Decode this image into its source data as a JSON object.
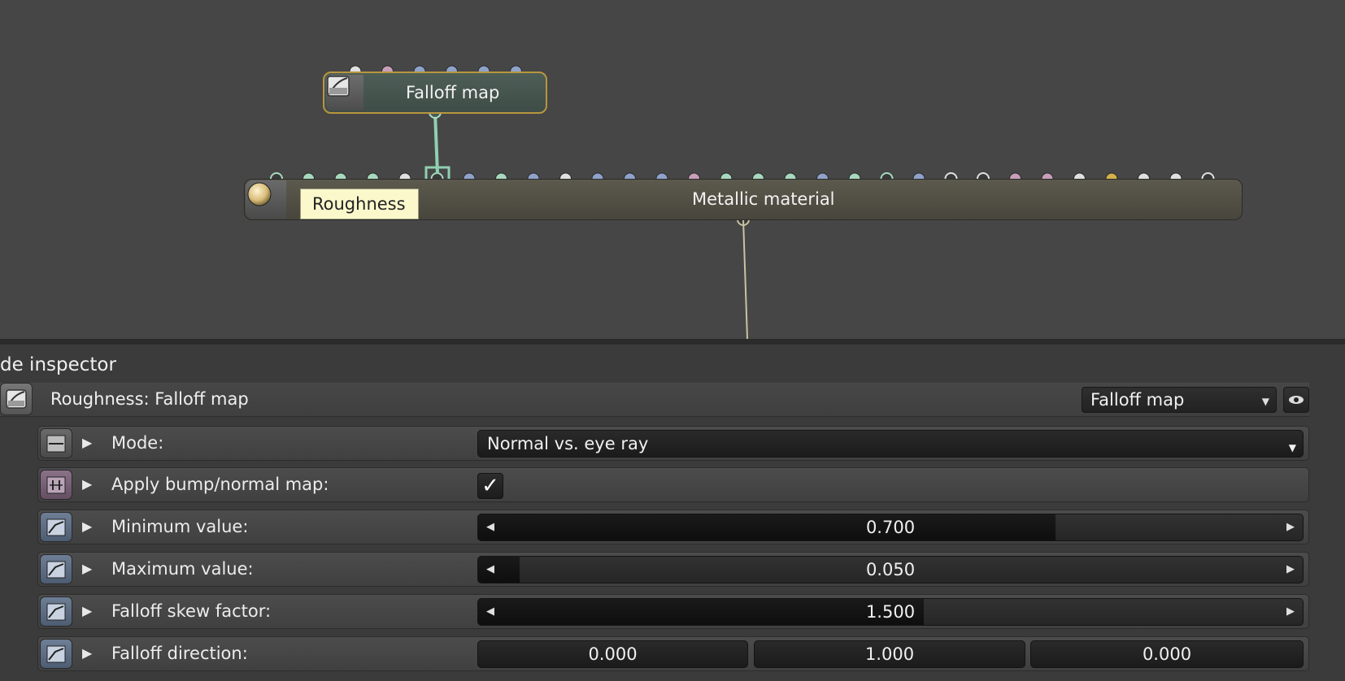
{
  "graph": {
    "falloff_node": {
      "title": "Falloff map",
      "icon": "falloff-map-icon"
    },
    "metallic_node": {
      "title": "Metallic material",
      "icon": "material-sphere-icon"
    },
    "tooltip": "Roughness",
    "colors": {
      "falloff_border": "#b8963e",
      "connection": "#8fd0b0",
      "output_wire": "#c9c2a2"
    }
  },
  "inspector": {
    "title": "de inspector",
    "header": {
      "label": "Roughness: Falloff map",
      "type_select": "Falloff map",
      "icon": "falloff-map-icon",
      "visibility_icon": "eye-icon"
    },
    "properties": [
      {
        "label": "Mode:",
        "kind": "select",
        "value": "Normal vs. eye ray",
        "icon": "enum-icon"
      },
      {
        "label": "Apply bump/normal map:",
        "kind": "checkbox",
        "checked": true,
        "check_glyph": "✓",
        "icon": "bool-icon"
      },
      {
        "label": "Minimum value:",
        "kind": "slider",
        "value": "0.700",
        "fraction": 0.7,
        "icon": "float-icon"
      },
      {
        "label": "Maximum value:",
        "kind": "slider",
        "value": "0.050",
        "fraction": 0.05,
        "icon": "float-icon"
      },
      {
        "label": "Falloff skew factor:",
        "kind": "slider",
        "value": "1.500",
        "fraction": 0.54,
        "icon": "float-icon"
      },
      {
        "label": "Falloff direction:",
        "kind": "vector",
        "values": [
          "0.000",
          "1.000",
          "0.000"
        ],
        "icon": "float-icon"
      }
    ],
    "arrows": {
      "expand": "▶",
      "left": "◀",
      "right": "▶",
      "dropdown": "▼"
    }
  }
}
